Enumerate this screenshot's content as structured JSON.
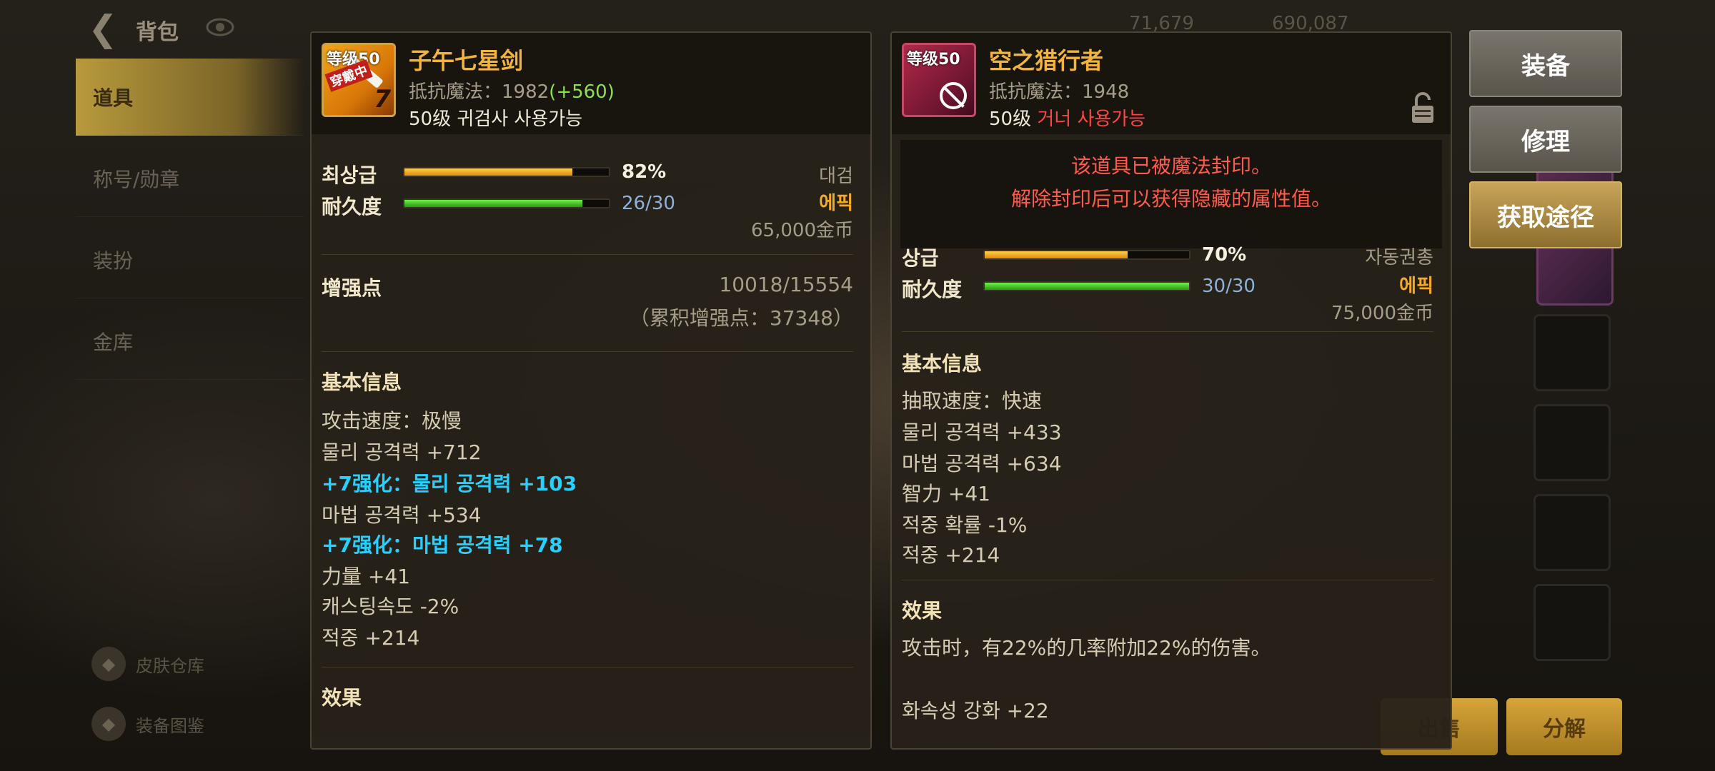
{
  "background": {
    "title": "背包",
    "sidebar": [
      {
        "label": "道具",
        "active": true
      },
      {
        "label": "称号/勋章",
        "active": false
      },
      {
        "label": "装扮",
        "active": false
      },
      {
        "label": "金库",
        "active": false
      }
    ],
    "bottom_links": [
      "皮肤仓库",
      "装备图鉴"
    ],
    "top_stats": [
      "71,679",
      "690,087"
    ],
    "bottom_buttons": [
      "出售",
      "分解"
    ]
  },
  "item1": {
    "icon_level": "等级50",
    "icon_tag": "穿戴中",
    "icon_number": "7",
    "name": "子午七星剑",
    "resist_label": "抵抗魔法：1982",
    "resist_bonus": "(+560)",
    "req": "50级 귀검사 사용가능",
    "grade_label": "최상급",
    "grade_pct": 82,
    "grade_text": "82%",
    "dur_label": "耐久度",
    "dur_pct": 87,
    "dur_text": "26/30",
    "type": "대검",
    "rarity": "에픽",
    "price": "65,000金币",
    "enh_label": "增强点",
    "enh_value": "10018/15554",
    "enh_total": "（累积增强点：37348）",
    "basic_title": "基本信息",
    "stats": [
      {
        "text": "攻击速度：极慢",
        "cyan": false
      },
      {
        "text": "물리 공격력 +712",
        "cyan": false
      },
      {
        "text": "+7强化：물리 공격력 +103",
        "cyan": true
      },
      {
        "text": "마법 공격력 +534",
        "cyan": false
      },
      {
        "text": "+7强化：마법 공격력 +78",
        "cyan": true
      },
      {
        "text": "力量 +41",
        "cyan": false
      },
      {
        "text": "캐스팅속도 -2%",
        "cyan": false
      },
      {
        "text": "적중 +214",
        "cyan": false
      }
    ],
    "effect_title": "效果"
  },
  "item2": {
    "icon_level": "等级50",
    "name": "空之猎行者",
    "resist_label": "抵抗魔法：1948",
    "req_prefix": "50级",
    "req_suffix": "거너 사용가능",
    "seal_line1": "该道具已被魔法封印。",
    "seal_line2": "解除封印后可以获得隐藏的属性值。",
    "grade_label": "상급",
    "grade_pct": 70,
    "grade_text": "70%",
    "dur_label": "耐久度",
    "dur_pct": 100,
    "dur_text": "30/30",
    "type": "자동권총",
    "rarity": "에픽",
    "price": "75,000金币",
    "basic_title": "基本信息",
    "stats": [
      "抽取速度：快速",
      "물리 공격력 +433",
      "마법 공격력 +634",
      "智力 +41",
      "적중 확률 -1%",
      "적중 +214"
    ],
    "effect_title": "效果",
    "effect_text": "攻击时，有22%的几率附加22%的伤害。",
    "extra": "화속성 강화 +22"
  },
  "actions": {
    "equip": "装备",
    "repair": "修理",
    "obtain": "获取途径"
  },
  "colors": {
    "name_gold": "#f2b43e",
    "epic": "#f4a928",
    "enhance_cyan": "#27d0ff",
    "bonus_green": "#8ee04a",
    "seal_red": "#ff5a4a"
  }
}
